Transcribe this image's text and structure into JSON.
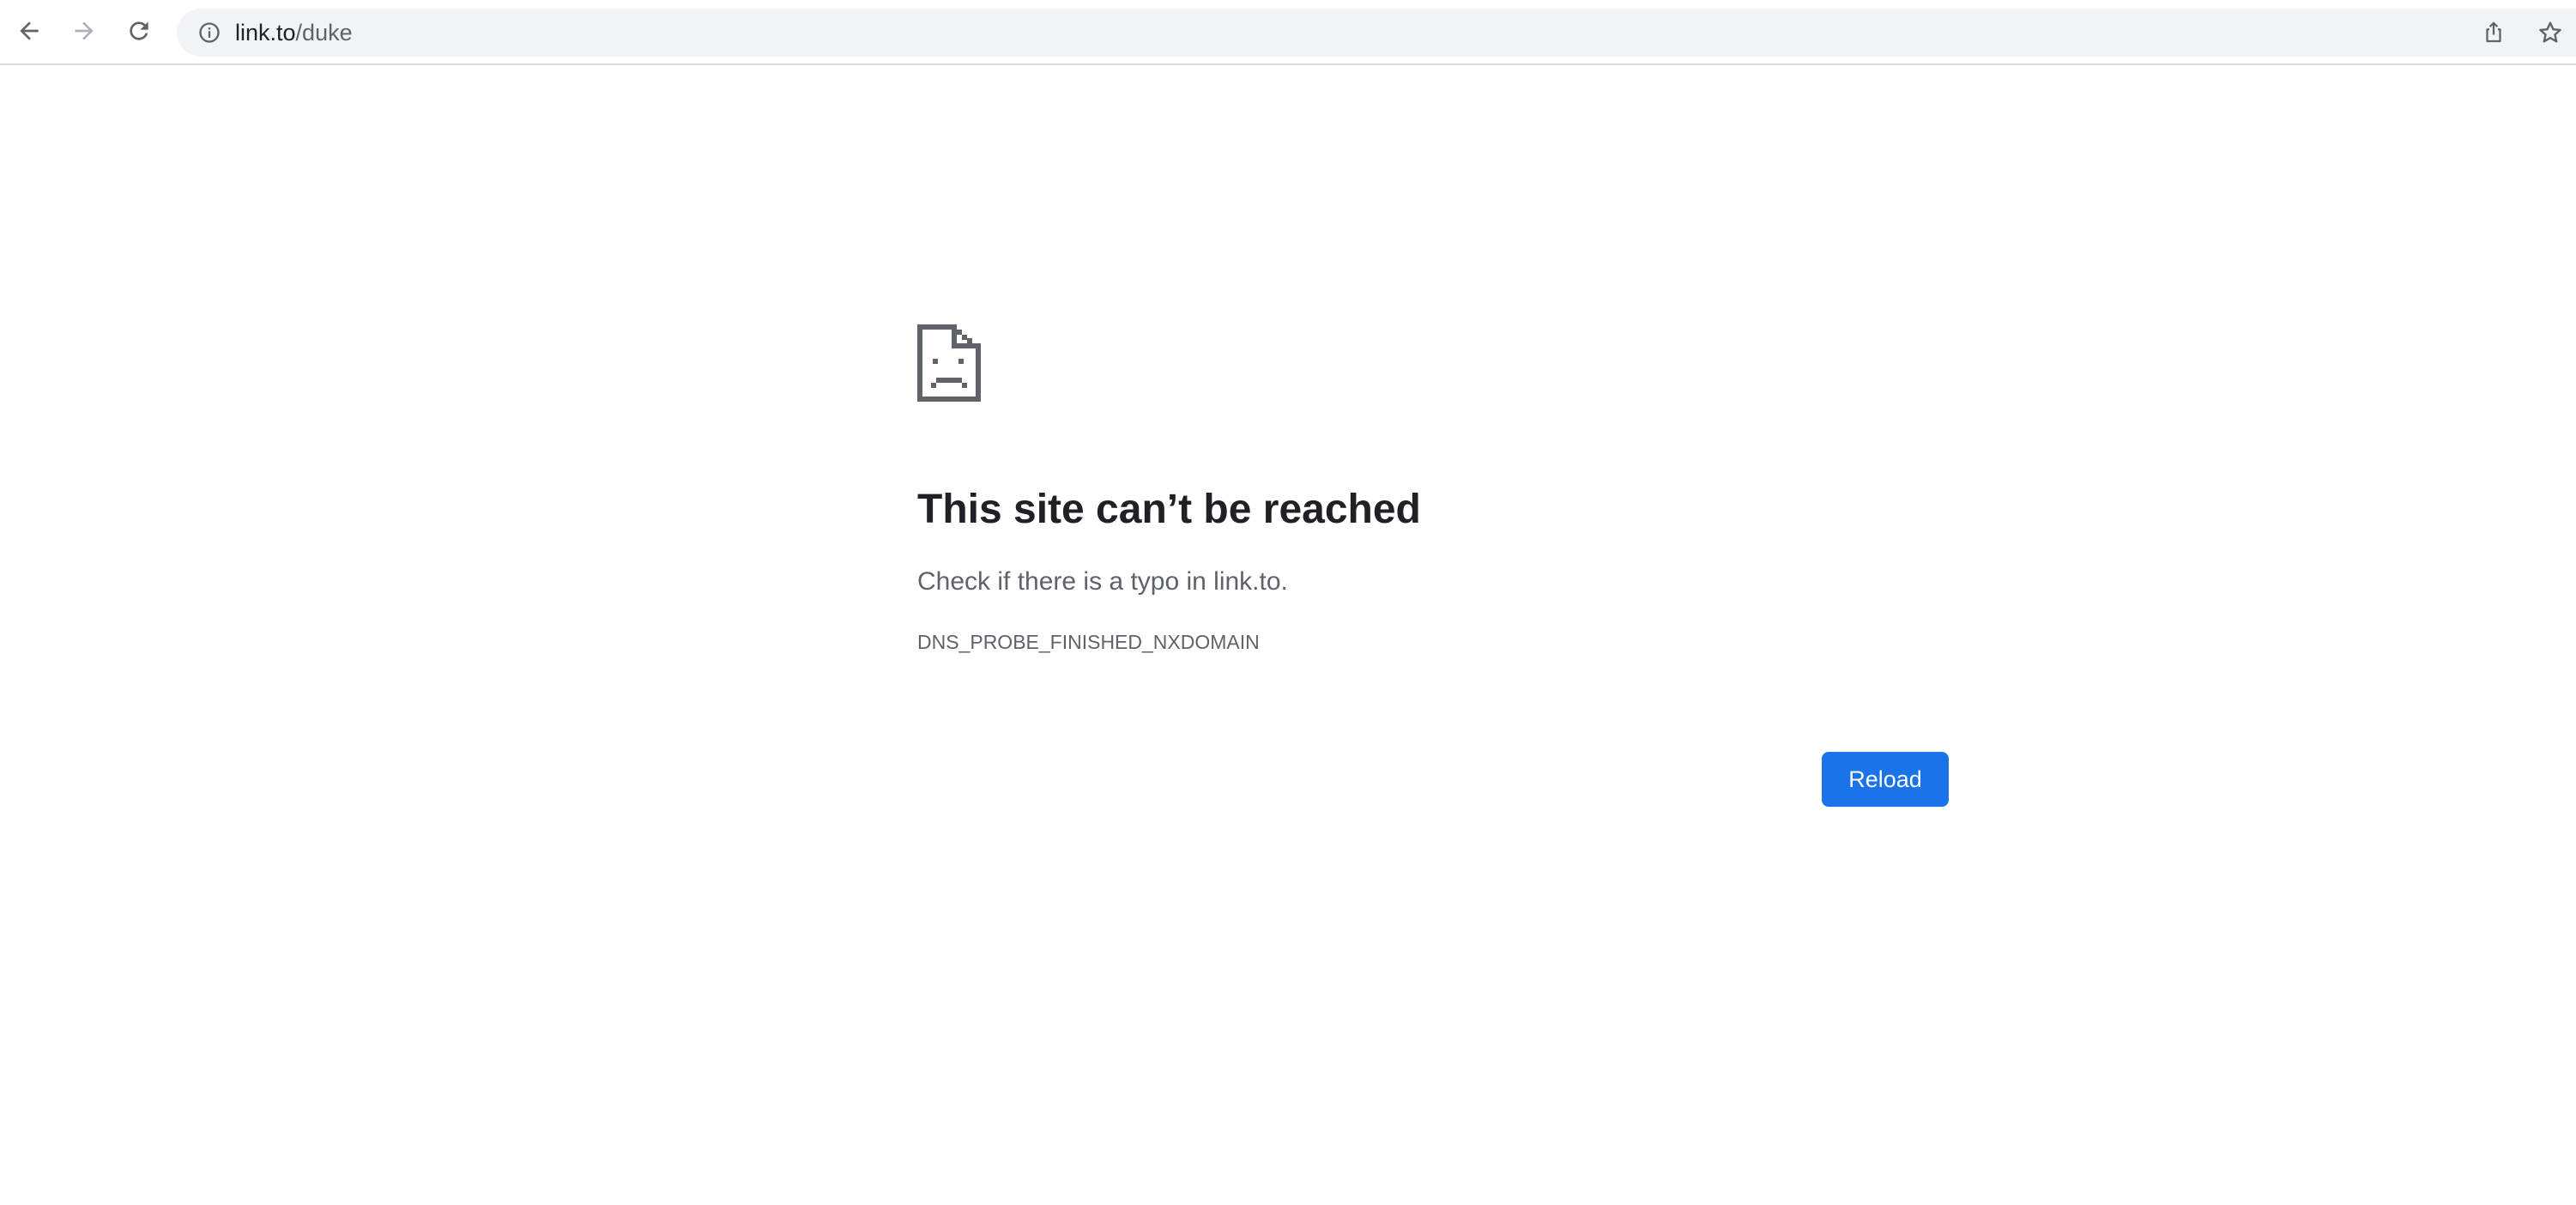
{
  "browser": {
    "url_host": "link.to",
    "url_path": "/duke",
    "icons": {
      "back": "arrow-left-icon",
      "forward": "arrow-right-icon",
      "reload": "reload-icon",
      "site_info": "info-circle-icon",
      "share": "share-icon",
      "bookmark": "star-icon"
    },
    "forward_enabled": false
  },
  "error_page": {
    "icon": "sad-document-icon",
    "heading": "This site can’t be reached",
    "suggestion": "Check if there is a typo in link.to.",
    "error_code": "DNS_PROBE_FINISHED_NXDOMAIN",
    "reload_label": "Reload"
  },
  "colors": {
    "accent": "#1a73e8",
    "heading": "#202124",
    "secondary_text": "#5f6368",
    "omnibox_bg": "#f1f3f4"
  }
}
